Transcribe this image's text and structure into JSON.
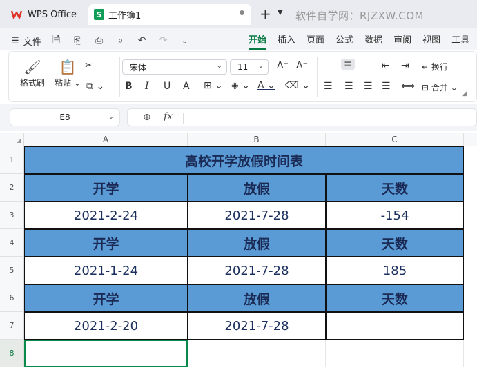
{
  "titlebar": {
    "app_tab": "WPS Office",
    "doc_tab": "工作簿1",
    "doc_icon_letter": "S",
    "plus": "+",
    "chevron": "⌄",
    "watermark": "软件自学网：RJZXW.COM"
  },
  "menubar": {
    "file_label": "文件",
    "tabs": [
      "开始",
      "插入",
      "页面",
      "公式",
      "数据",
      "审阅",
      "视图",
      "工具"
    ],
    "active_tab": "开始"
  },
  "ribbon": {
    "format_painter": "格式刷",
    "paste": "粘贴",
    "font_name": "宋体",
    "font_size": "11",
    "wrap": "换行",
    "merge": "合并"
  },
  "formula_bar": {
    "name_box": "E8",
    "fx": "fx",
    "formula": ""
  },
  "sheet": {
    "columns": [
      "A",
      "B",
      "C"
    ],
    "rows": [
      "1",
      "2",
      "3",
      "4",
      "5",
      "6",
      "7",
      "8"
    ],
    "active_row": "8",
    "title": "高校开学放假时间表",
    "header": {
      "a": "开学",
      "b": "放假",
      "c": "天数"
    },
    "data": [
      {
        "a": "2021-2-24",
        "b": "2021-7-28",
        "c": "-154"
      },
      {
        "a": "2021-1-24",
        "b": "2021-7-28",
        "c": "185"
      },
      {
        "a": "2021-2-20",
        "b": "2021-7-28",
        "c": ""
      }
    ]
  },
  "colors": {
    "accent": "#0a7a44",
    "header_fill": "#5b9bd5",
    "text_dark": "#1b2f5e"
  }
}
